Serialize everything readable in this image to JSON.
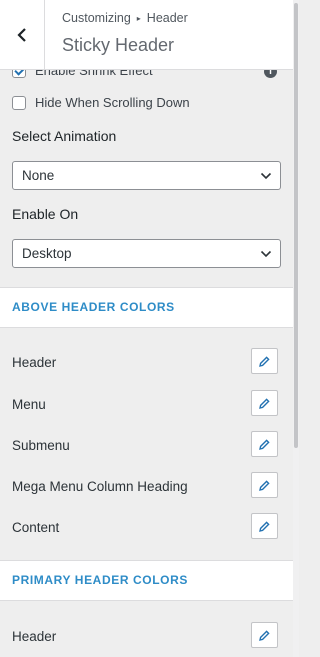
{
  "header": {
    "breadcrumb_root": "Customizing",
    "breadcrumb_separator": "▸",
    "breadcrumb_current": "Header",
    "title": "Sticky Header"
  },
  "options": {
    "enable_shrink": {
      "label": "Enable Shrink Effect",
      "checked": true
    },
    "hide_scroll": {
      "label": "Hide When Scrolling Down",
      "checked": false
    }
  },
  "animation": {
    "label": "Select Animation",
    "value": "None"
  },
  "enable_on": {
    "label": "Enable On",
    "value": "Desktop"
  },
  "above_header": {
    "title": "ABOVE HEADER COLORS",
    "items": [
      "Header",
      "Menu",
      "Submenu",
      "Mega Menu Column Heading",
      "Content"
    ]
  },
  "primary_header": {
    "title": "PRIMARY HEADER COLORS",
    "items": [
      "Header"
    ]
  },
  "icons": {
    "back": "chevron-left-icon",
    "info": "info-icon",
    "dropdown": "chevron-down-icon",
    "color_picker": "pencil-icon"
  },
  "colors": {
    "accent": "#2e8cc7",
    "checkbox_check": "#2271b1",
    "picker_icon": "#2271b1"
  }
}
